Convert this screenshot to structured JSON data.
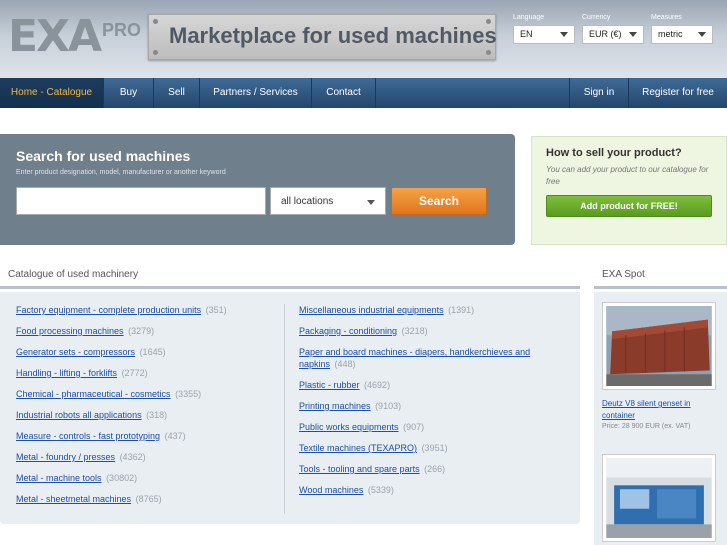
{
  "header": {
    "logo": "EXA",
    "logo_suffix": "PRO",
    "banner": "Marketplace for used machines",
    "language_label": "Language",
    "language_value": "EN",
    "currency_label": "Currency",
    "currency_value": "EUR (€)",
    "measures_label": "Measures",
    "measures_value": "metric"
  },
  "nav": {
    "home": "Home - Catalogue",
    "buy": "Buy",
    "sell": "Sell",
    "partners": "Partners / Services",
    "contact": "Contact",
    "signin": "Sign in",
    "register": "Register for free"
  },
  "search": {
    "title": "Search for used machines",
    "hint": "Enter product designation, model, manufacturer or another keyword",
    "input_value": "",
    "location": "all locations",
    "button": "Search"
  },
  "sell_panel": {
    "title": "How to sell your product?",
    "desc": "You can add your product to our catalogue for free",
    "button": "Add product for FREE!"
  },
  "catalogue": {
    "title": "Catalogue of used machinery",
    "left": [
      {
        "label": "Factory equipment - complete production units",
        "count": "(351)"
      },
      {
        "label": "Food processing machines",
        "count": "(3279)"
      },
      {
        "label": "Generator sets - compressors",
        "count": "(1645)"
      },
      {
        "label": "Handling - lifting - forklifts",
        "count": "(2772)"
      },
      {
        "label": "Chemical - pharmaceutical - cosmetics",
        "count": "(3355)"
      },
      {
        "label": "Industrial robots all applications",
        "count": "(318)"
      },
      {
        "label": "Measure - controls - fast prototyping",
        "count": "(437)"
      },
      {
        "label": "Metal - foundry / presses",
        "count": "(4362)"
      },
      {
        "label": "Metal - machine tools",
        "count": "(30802)"
      },
      {
        "label": "Metal - sheetmetal machines",
        "count": "(8765)"
      }
    ],
    "right": [
      {
        "label": "Miscellaneous industrial equipments",
        "count": "(1391)"
      },
      {
        "label": "Packaging - conditioning",
        "count": "(3218)"
      },
      {
        "label": "Paper and board machines - diapers, handkerchieves and napkins",
        "count": "(448)"
      },
      {
        "label": "Plastic - rubber",
        "count": "(4692)"
      },
      {
        "label": "Printing machines",
        "count": "(9103)"
      },
      {
        "label": "Public works equipments",
        "count": "(907)"
      },
      {
        "label": "Textile machines (TEXAPRO)",
        "count": "(3951)"
      },
      {
        "label": "Tools - tooling and spare parts",
        "count": "(266)"
      },
      {
        "label": "Wood machines",
        "count": "(5339)"
      }
    ]
  },
  "spot": {
    "title": "EXA Spot",
    "item_name": "Deutz V8 silent genset in container",
    "item_price": "Price: 28 900 EUR (ex. VAT)"
  }
}
